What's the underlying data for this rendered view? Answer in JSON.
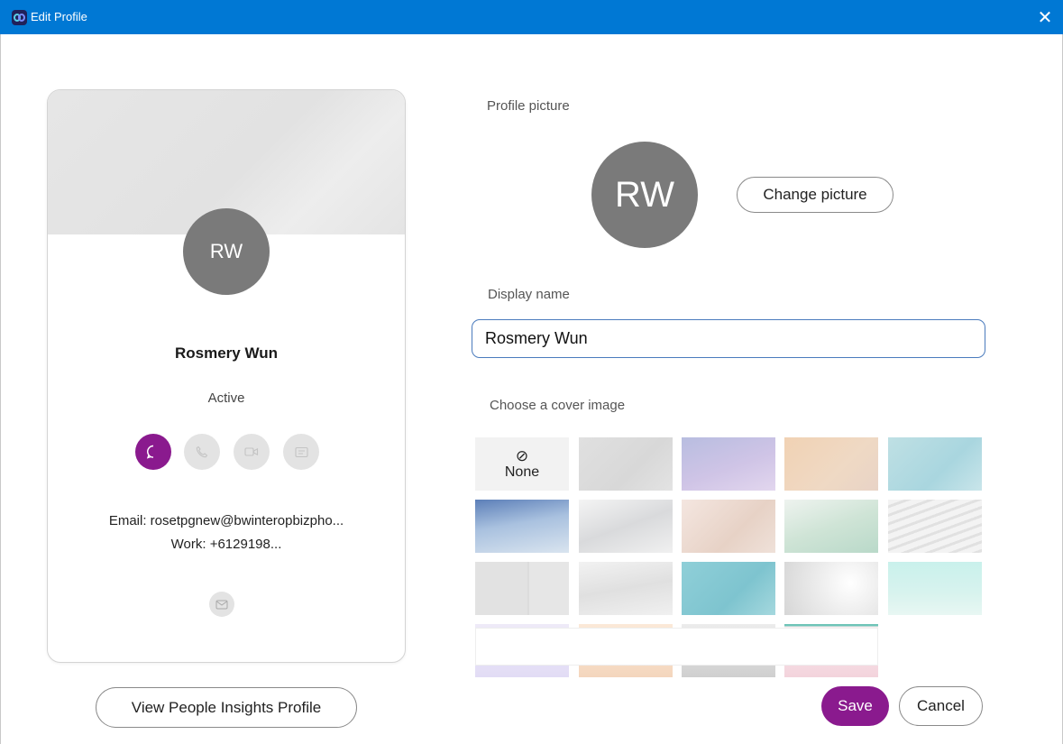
{
  "window": {
    "title": "Edit Profile",
    "close_symbol": "✕"
  },
  "card": {
    "initials": "RW",
    "name": "Rosmery Wun",
    "status": "Active",
    "email_line": "Email: rosetpgnew@bwinteropbizpho...",
    "work_line": "Work: +6129198...",
    "actions": [
      "chat-icon",
      "phone-icon",
      "video-icon",
      "contact-card-icon"
    ],
    "accent_color": "#8a1a8e"
  },
  "view_insights_label": "View People Insights Profile",
  "profile_picture": {
    "label": "Profile picture",
    "initials": "RW",
    "change_label": "Change picture"
  },
  "display_name": {
    "label": "Display name",
    "value": "Rosmery Wun"
  },
  "cover": {
    "label": "Choose a cover image",
    "none_symbol": "⊘",
    "none_label": "None",
    "selected": "None"
  },
  "footer": {
    "save_label": "Save",
    "cancel_label": "Cancel"
  }
}
